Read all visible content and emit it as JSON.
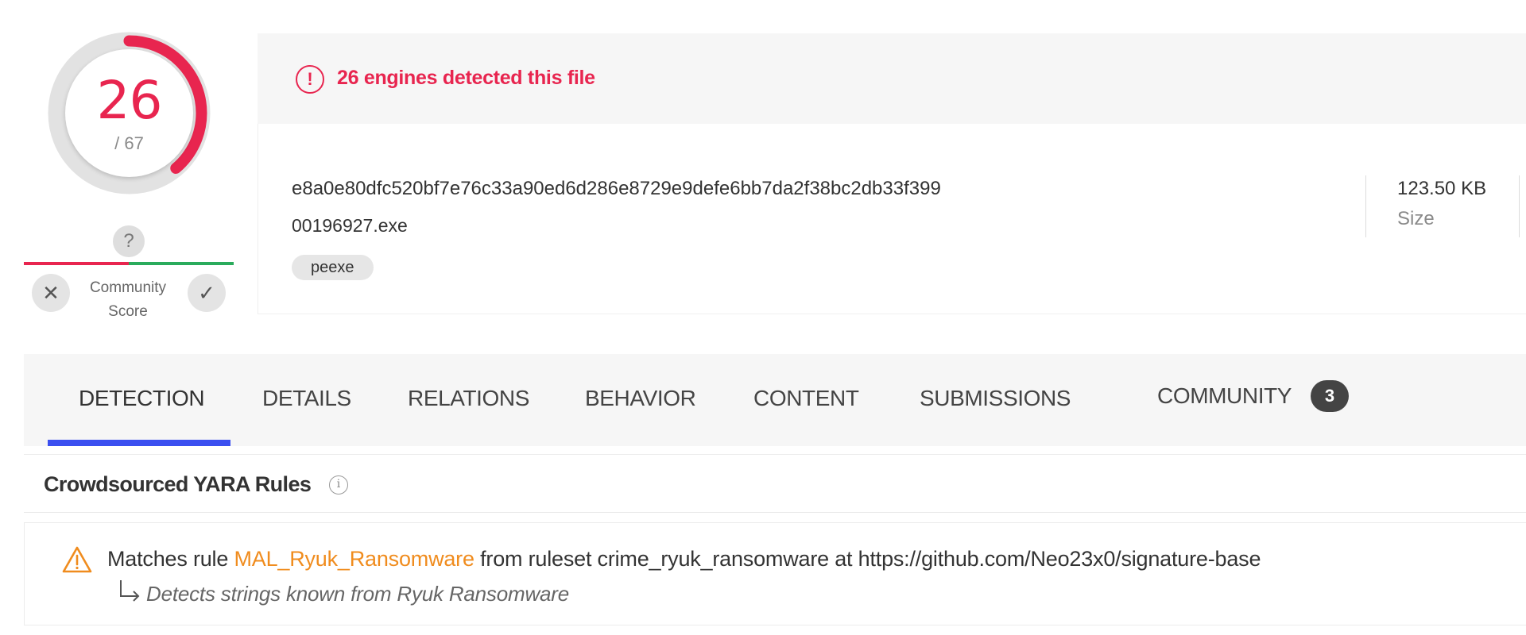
{
  "score": {
    "detections": "26",
    "total": "/ 67",
    "detections_value": 26,
    "total_value": 67,
    "accent_color": "#e8254f"
  },
  "community": {
    "marker": "?",
    "label_line1": "Community",
    "label_line2": "Score",
    "downvote_icon": "close-icon",
    "upvote_icon": "check-icon",
    "downvote_glyph": "✕",
    "upvote_glyph": "✓"
  },
  "banner": {
    "icon": "alert-circle-icon",
    "icon_glyph": "!",
    "message": "26 engines detected this file",
    "color": "#e8254f"
  },
  "file": {
    "sha256": "e8a0e80dfc520bf7e76c33a90ed6d286e8729e9defe6bb7da2f38bc2db33f399",
    "name": "00196927.exe",
    "tag": "peexe",
    "size_value": "123.50 KB",
    "size_label": "Size"
  },
  "tabs": {
    "items": [
      {
        "label": "DETECTION",
        "active": true
      },
      {
        "label": "DETAILS",
        "active": false
      },
      {
        "label": "RELATIONS",
        "active": false
      },
      {
        "label": "BEHAVIOR",
        "active": false
      },
      {
        "label": "CONTENT",
        "active": false
      },
      {
        "label": "SUBMISSIONS",
        "active": false
      },
      {
        "label": "COMMUNITY",
        "active": false,
        "badge": "3"
      }
    ],
    "active_color": "#3b4ff0"
  },
  "yara": {
    "title": "Crowdsourced YARA Rules",
    "info_icon": "info-icon",
    "info_glyph": "i",
    "rule": {
      "prefix": "Matches rule ",
      "name": "MAL_Ryuk_Ransomware",
      "suffix": " from ruleset crime_ryuk_ransomware at https://github.com/Neo23x0/signature-base",
      "description": "Detects strings known from Ryuk Ransomware",
      "warning_icon": "warning-icon",
      "name_color": "#f08c1e"
    }
  }
}
